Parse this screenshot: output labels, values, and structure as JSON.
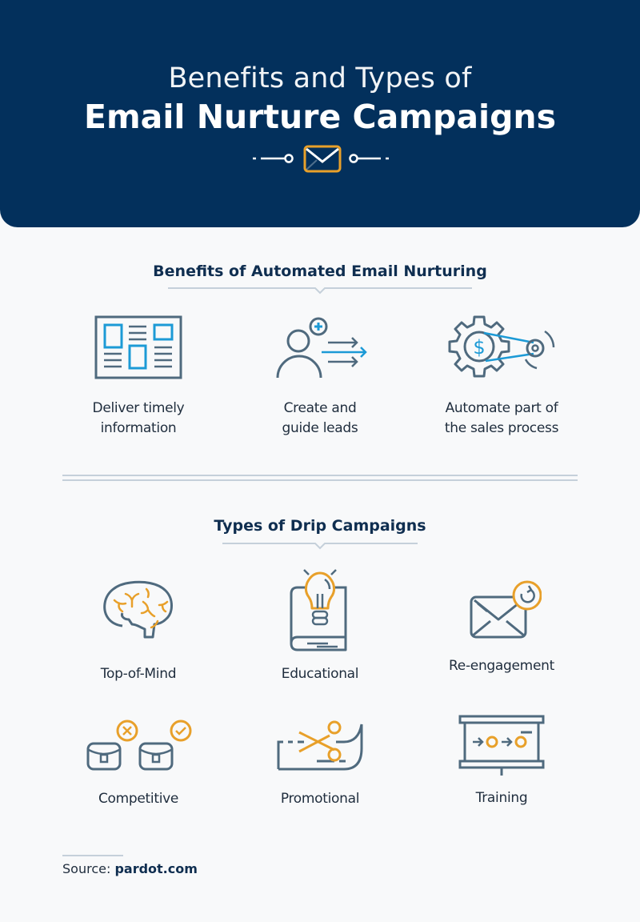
{
  "header": {
    "title_line1": "Benefits and Types of",
    "title_line2": "Email Nurture Campaigns",
    "divider_icon": "envelope-icon"
  },
  "benefits": {
    "heading": "Benefits of Automated Email Nurturing",
    "items": [
      {
        "icon": "newsletter-layout-icon",
        "line1": "Deliver timely",
        "line2": "information"
      },
      {
        "icon": "add-user-arrows-icon",
        "line1": "Create and",
        "line2": "guide leads"
      },
      {
        "icon": "gear-dollar-icon",
        "line1": "Automate part of",
        "line2": "the sales process"
      }
    ]
  },
  "types": {
    "heading": "Types of Drip Campaigns",
    "items": [
      {
        "icon": "brain-icon",
        "label": "Top-of-Mind"
      },
      {
        "icon": "book-lightbulb-icon",
        "label": "Educational"
      },
      {
        "icon": "envelope-refresh-icon",
        "label": "Re-engagement"
      },
      {
        "icon": "briefcases-compare-icon",
        "label": "Competitive"
      },
      {
        "icon": "coupon-scissors-icon",
        "label": "Promotional"
      },
      {
        "icon": "presentation-board-icon",
        "label": "Training"
      }
    ]
  },
  "source": {
    "prefix": "Source:",
    "name": "pardot.com"
  },
  "colors": {
    "header_bg": "#03305c",
    "page_bg": "#f8f9fa",
    "icon_slate": "#4f6a7e",
    "icon_blue": "#1c9ad6",
    "icon_orange": "#e8a02a",
    "heading_text": "#0f2e50",
    "rule": "#c5d0da"
  }
}
